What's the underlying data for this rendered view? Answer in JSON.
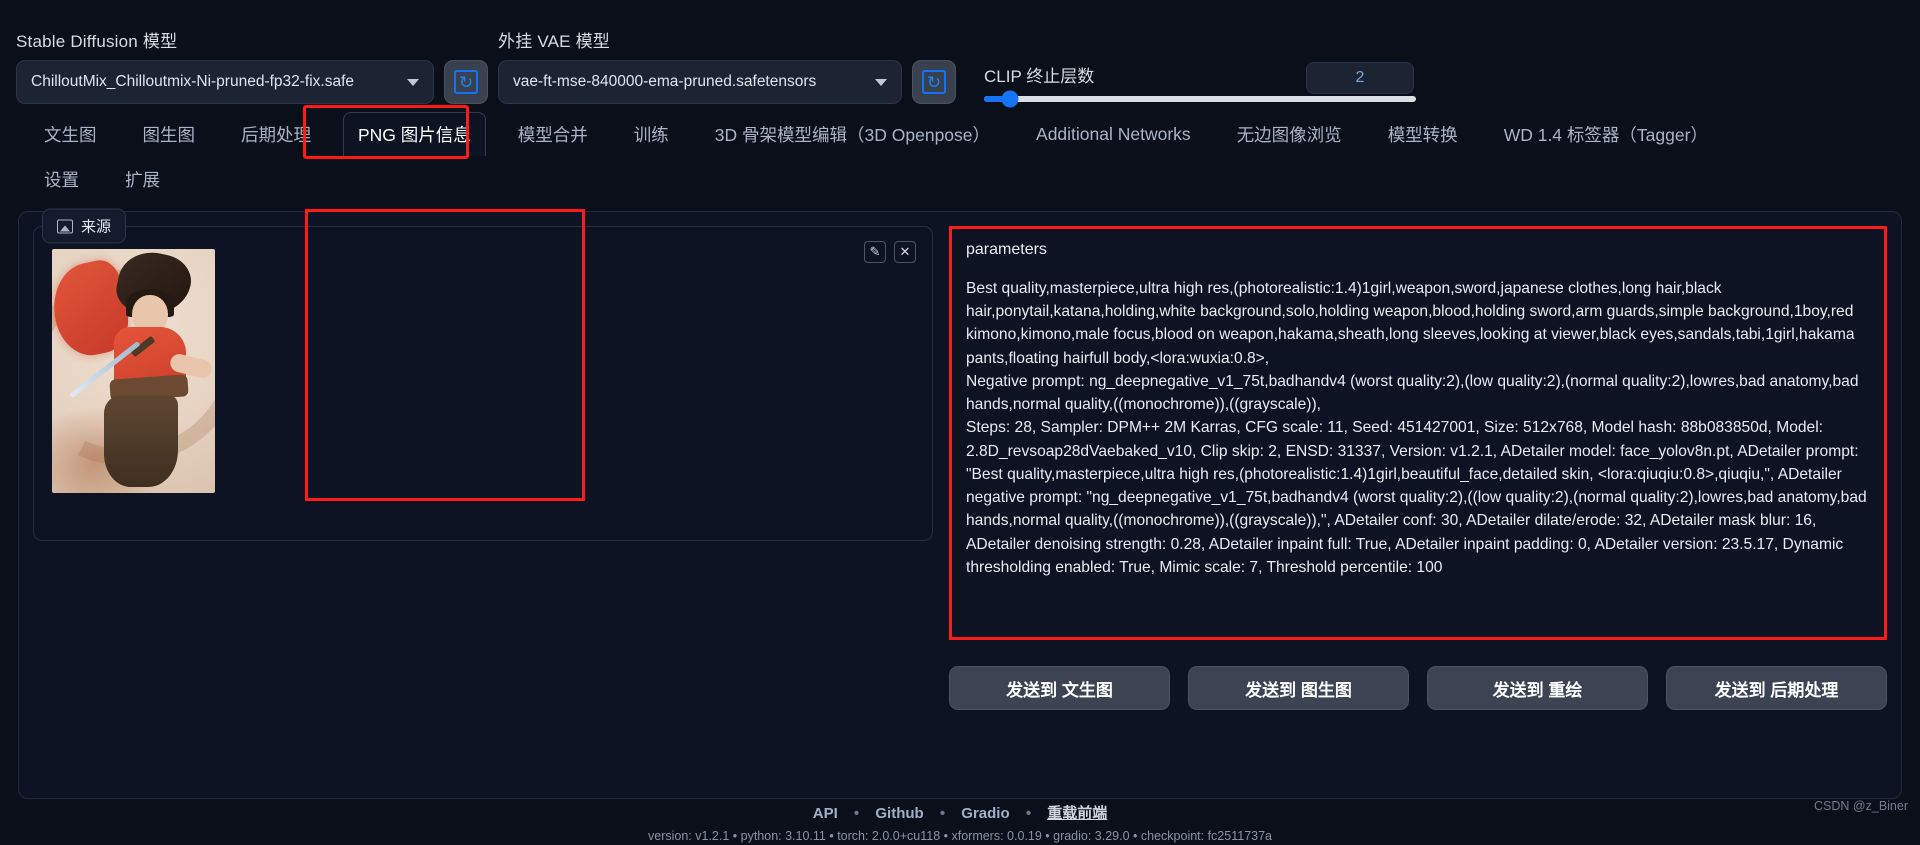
{
  "topbar": {
    "sd_model": {
      "label": "Stable Diffusion 模型",
      "value": "ChilloutMix_Chilloutmix-Ni-pruned-fp32-fix.safe"
    },
    "refresh_sd_icon": "refresh-icon",
    "vae_model": {
      "label": "外挂 VAE 模型",
      "value": "vae-ft-mse-840000-ema-pruned.safetensors"
    },
    "refresh_vae_icon": "refresh-icon",
    "clip": {
      "label": "CLIP 终止层数",
      "value": "2",
      "min": 1,
      "max": 12,
      "percent": 6
    }
  },
  "tabs": {
    "row1": [
      {
        "label": "文生图",
        "active": false
      },
      {
        "label": "图生图",
        "active": false
      },
      {
        "label": "后期处理",
        "active": false
      },
      {
        "label": "PNG 图片信息",
        "active": true
      },
      {
        "label": "模型合并",
        "active": false
      },
      {
        "label": "训练",
        "active": false
      },
      {
        "label": "3D 骨架模型编辑（3D Openpose）",
        "active": false
      },
      {
        "label": "Additional Networks",
        "active": false
      },
      {
        "label": "无边图像浏览",
        "active": false
      },
      {
        "label": "模型转换",
        "active": false
      },
      {
        "label": "WD 1.4 标签器（Tagger）",
        "active": false
      }
    ],
    "row2": [
      {
        "label": "设置",
        "active": false
      },
      {
        "label": "扩展",
        "active": false
      }
    ]
  },
  "source_panel": {
    "tab_label": "来源",
    "tab_icon": "image-icon",
    "edit_icon": "pencil-icon",
    "close_icon": "close-icon"
  },
  "parameters": {
    "title": "parameters",
    "text": "Best quality,masterpiece,ultra high res,(photorealistic:1.4)1girl,weapon,sword,japanese clothes,long hair,black hair,ponytail,katana,holding,white background,solo,holding weapon,blood,holding sword,arm guards,simple background,1boy,red kimono,kimono,male focus,blood on weapon,hakama,sheath,long sleeves,looking at viewer,black eyes,sandals,tabi,1girl,hakama pants,floating hairfull body,<lora:wuxia:0.8>,\nNegative prompt: ng_deepnegative_v1_75t,badhandv4 (worst quality:2),(low quality:2),(normal quality:2),lowres,bad anatomy,bad hands,normal quality,((monochrome)),((grayscale)),\nSteps: 28, Sampler: DPM++ 2M Karras, CFG scale: 11, Seed: 451427001, Size: 512x768, Model hash: 88b083850d, Model: 2.8D_revsoap28dVaebaked_v10, Clip skip: 2, ENSD: 31337, Version: v1.2.1, ADetailer model: face_yolov8n.pt, ADetailer prompt: \"Best quality,masterpiece,ultra high res,(photorealistic:1.4)1girl,beautiful_face,detailed skin, <lora:qiuqiu:0.8>,qiuqiu,\", ADetailer negative prompt: \"ng_deepnegative_v1_75t,badhandv4 (worst quality:2),((low quality:2),(normal quality:2),lowres,bad anatomy,bad hands,normal quality,((monochrome)),((grayscale)),\", ADetailer conf: 30, ADetailer dilate/erode: 32, ADetailer mask blur: 16, ADetailer denoising strength: 0.28, ADetailer inpaint full: True, ADetailer inpaint padding: 0, ADetailer version: 23.5.17, Dynamic thresholding enabled: True, Mimic scale: 7, Threshold percentile: 100"
  },
  "send_buttons": [
    {
      "label": "发送到 文生图"
    },
    {
      "label": "发送到 图生图"
    },
    {
      "label": "发送到 重绘"
    },
    {
      "label": "发送到 后期处理"
    }
  ],
  "footer": {
    "links": [
      {
        "label": "API"
      },
      {
        "label": "Github"
      },
      {
        "label": "Gradio"
      },
      {
        "label": "重载前端"
      }
    ],
    "separator": "•",
    "version": "version: v1.2.1  •  python: 3.10.11  •  torch: 2.0.0+cu118  •  xformers: 0.0.19  •  gradio: 3.29.0  •  checkpoint: fc2511737a",
    "watermark": "CSDN @z_Biner"
  },
  "colors": {
    "accent": "#1573f5",
    "highlight": "#ff1a1a",
    "panel": "#0d1322",
    "background": "#0b0f19"
  }
}
